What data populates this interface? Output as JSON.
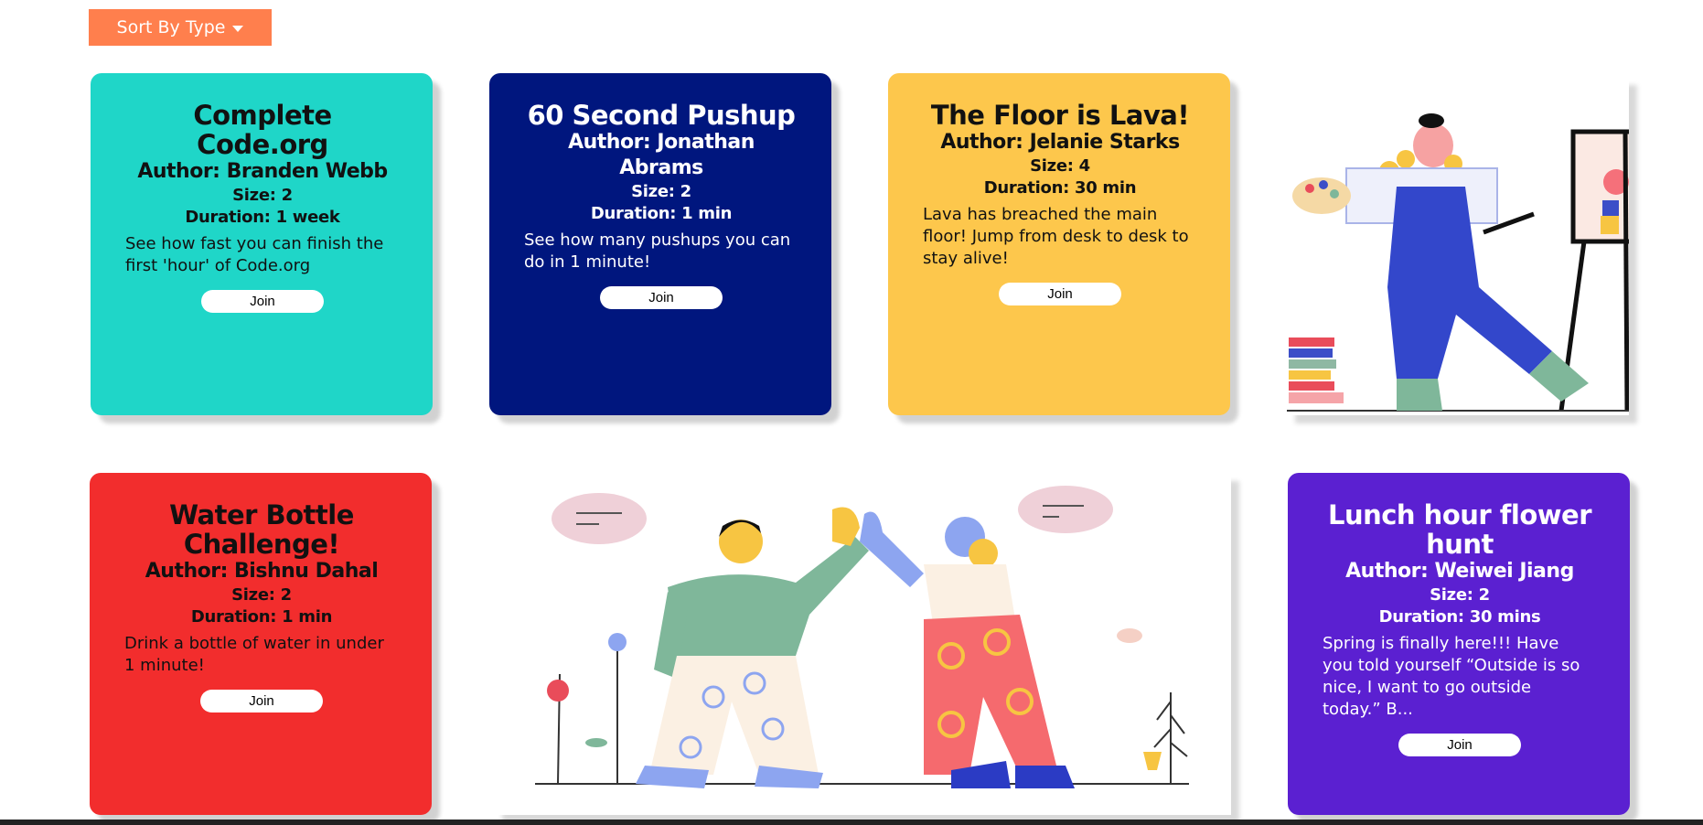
{
  "toolbar": {
    "sort_label": "Sort By Type"
  },
  "join_label": "Join",
  "colors": {
    "sort_button": "#ff7f4d",
    "teal": "#1fd6c8",
    "navy": "#00167e",
    "yellow": "#fdc74c",
    "red": "#f22d2d",
    "purple": "#5b20d1"
  },
  "cards": [
    {
      "title": "Complete Code.org",
      "author": "Author: Branden Webb",
      "size": "Size: 2",
      "duration": "Duration: 1 week",
      "description": "See how fast you can finish the first 'hour' of Code.org"
    },
    {
      "title": "60 Second Pushup",
      "author": "Author: Jonathan Abrams",
      "size": "Size: 2",
      "duration": "Duration: 1 min",
      "description": "See how many pushups you can do in 1 minute!"
    },
    {
      "title": "The Floor is Lava!",
      "author": "Author: Jelanie Starks",
      "size": "Size: 4",
      "duration": "Duration: 30 min",
      "description": "Lava has breached the main floor! Jump from desk to desk to stay alive!"
    },
    {
      "title": "Water Bottle Challenge!",
      "author": "Author: Bishnu Dahal",
      "size": "Size: 2",
      "duration": "Duration: 1 min",
      "description": "Drink a bottle of water in under 1 minute!"
    },
    {
      "title": "Lunch hour flower hunt",
      "author": "Author: Weiwei Jiang",
      "size": "Size: 2",
      "duration": "Duration: 30 mins",
      "description": "Spring is finally here!!! Have you told yourself “Outside is so nice, I want to go outside today.” B..."
    }
  ],
  "illustrations": [
    {
      "icon": "painter-illustration"
    },
    {
      "icon": "high-five-illustration"
    }
  ]
}
